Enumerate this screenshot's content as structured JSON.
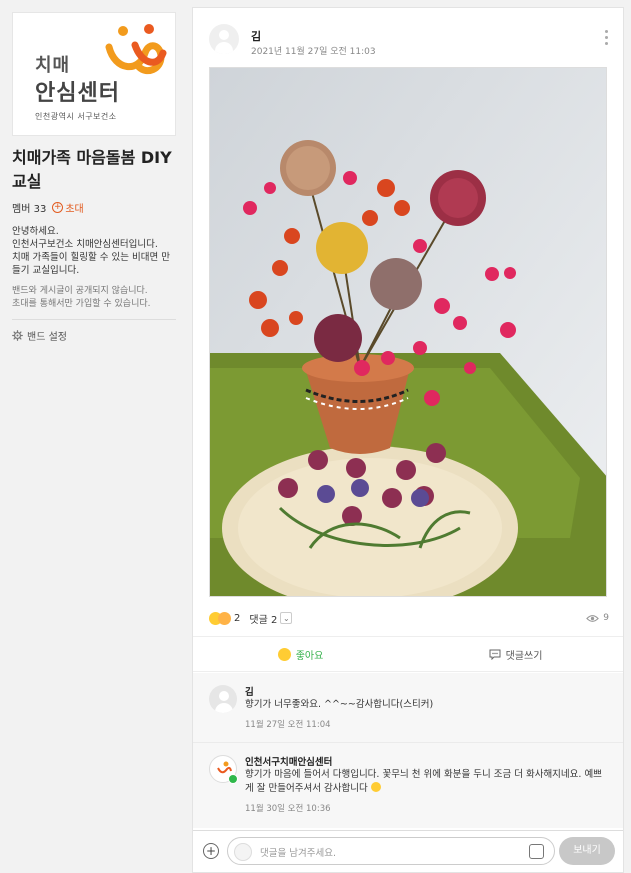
{
  "sidebar": {
    "cover": {
      "line1": "치매",
      "line2": "안심센터",
      "line3": "인천광역시 서구보건소"
    },
    "band_name": "치매가족 마음돌봄 DIY 교실",
    "members_label": "멤버 33",
    "invite_label": "초대",
    "description": "안녕하세요.\n인천서구보건소 치매안심센터입니다.\n치매 가족들이 힐링할 수 있는 비대면 만들기 교실입니다.",
    "privacy_notice": "밴드와 게시글이 공개되지 않습니다.\n초대를 통해서만 가입할 수 있습니다.",
    "settings_label": "밴드 설정"
  },
  "post": {
    "author": "김",
    "date": "2021년 11월 27일 오전 11:03",
    "reaction_count": "2",
    "comment_count_label": "댓글 2",
    "view_count": "9",
    "like_label": "좋아요",
    "comment_write_label": "댓글쓰기"
  },
  "comments": [
    {
      "name": "김",
      "text": "향기가 너무좋와요. ^^~~감사합니다(스티커)",
      "date": "11월 27일 오전 11:04"
    },
    {
      "name": "인천서구치매안심센터",
      "text": "향기가 마음에 들어서 다행입니다. 꽃무늬 천 위에 화분을 두니 조금 더 화사해지네요. 예쁘게 잘 만들어주셔서 감사합니다",
      "date": "11월 30일 오전 10:36"
    }
  ],
  "composer": {
    "placeholder": "댓글을 남겨주세요.",
    "send_label": "보내기"
  },
  "colors": {
    "accent_orange": "#e25b1f",
    "like_green": "#37b24d"
  }
}
